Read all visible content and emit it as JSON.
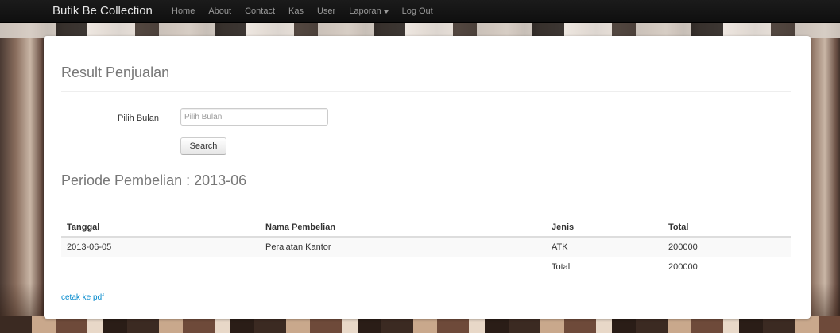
{
  "navbar": {
    "brand": "Butik Be Collection",
    "items": [
      {
        "label": "Home"
      },
      {
        "label": "About"
      },
      {
        "label": "Contact"
      },
      {
        "label": "Kas"
      },
      {
        "label": "User"
      },
      {
        "label": "Laporan",
        "dropdown": true
      },
      {
        "label": "Log Out"
      }
    ]
  },
  "main": {
    "title": "Result Penjualan",
    "form": {
      "label": "Pilih Bulan",
      "placeholder": "Pilih Bulan",
      "value": "",
      "search_label": "Search"
    },
    "period_title": "Periode Pembelian : 2013-06",
    "table": {
      "headers": [
        "Tanggal",
        "Nama Pembelian",
        "Jenis",
        "Total"
      ],
      "rows": [
        [
          "2013-06-05",
          "Peralatan Kantor",
          "ATK",
          "200000"
        ]
      ],
      "total_row": [
        "",
        "",
        "Total",
        "200000"
      ]
    },
    "pdf_link": "cetak ke pdf"
  },
  "colors": {
    "navbar_bg": "#1b1b1b",
    "link": "#0088cc"
  }
}
